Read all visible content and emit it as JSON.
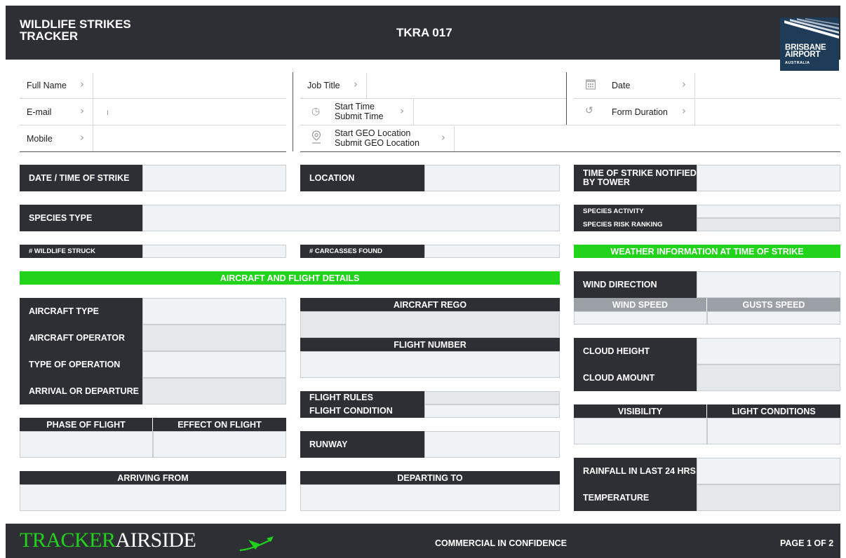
{
  "header": {
    "title": "WILDLIFE STRIKES\nTRACKER",
    "code": "TKRA 017"
  },
  "logo": {
    "line1": "BRISBANE",
    "line2": "AIRPORT",
    "line3": "AUSTRALIA"
  },
  "meta": {
    "full_name": "Full Name",
    "email": "E-mail",
    "mobile": "Mobile",
    "job_title": "Job Title",
    "start_time": "Start Time",
    "submit_time": "Submit Time",
    "start_geo": "Start GEO Location",
    "submit_geo": "Submit GEO Location",
    "date": "Date",
    "form_duration": "Form Duration",
    "chevron": "›"
  },
  "form": {
    "date_time": "DATE / TIME OF STRIKE",
    "location": "LOCATION",
    "time_notified": "TIME OF STRIKE NOTIFIED BY TOWER",
    "species_type": "SPECIES TYPE",
    "species_activity": "SPECIES ACTIVITY",
    "species_risk": "SPECIES RISK RANKING",
    "wildlife_struck": "# WILDLIFE STRUCK",
    "carcasses_found": "# CARCASSES FOUND",
    "weather_header": "WEATHER INFORMATION AT TIME OF STRIKE",
    "aircraft_header": "AIRCRAFT AND FLIGHT DETAILS",
    "aircraft_type": "AIRCRAFT TYPE",
    "aircraft_operator": "AIRCRAFT OPERATOR",
    "type_operation": "TYPE OF OPERATION",
    "arrival_departure": "ARRIVAL OR DEPARTURE",
    "aircraft_rego": "AIRCRAFT REGO",
    "flight_number": "FLIGHT NUMBER",
    "flight_rules": "FLIGHT RULES",
    "flight_condition": "FLIGHT CONDITION",
    "runway": "RUNWAY",
    "phase_flight": "PHASE OF FLIGHT",
    "effect_flight": "EFFECT ON FLIGHT",
    "arriving_from": "ARRIVING FROM",
    "departing_to": "DEPARTING TO",
    "wind_direction": "WIND DIRECTION",
    "wind_speed": "WIND SPEED",
    "gusts_speed": "GUSTS SPEED",
    "cloud_height": "CLOUD HEIGHT",
    "cloud_amount": "CLOUD AMOUNT",
    "visibility": "VISIBILITY",
    "light_conditions": "LIGHT CONDITIONS",
    "rainfall": "RAINFALL IN LAST 24 HRS",
    "temperature": "TEMPERATURE"
  },
  "footer": {
    "brand_main": "TRACKER",
    "brand_sub": "AIRSIDE",
    "confidential": "COMMERCIAL IN CONFIDENCE",
    "page": "PAGE 1 OF 2"
  },
  "colors": {
    "dark": "#2e2f34",
    "green": "#22d31c",
    "field": "#f0f3f5",
    "grey_header": "#9ba0a6"
  },
  "icons": {
    "date": "calendar-icon",
    "duration": "stopwatch-icon",
    "time": "clock-icon",
    "geo": "location-pin-icon",
    "plane": "plane-icon"
  }
}
